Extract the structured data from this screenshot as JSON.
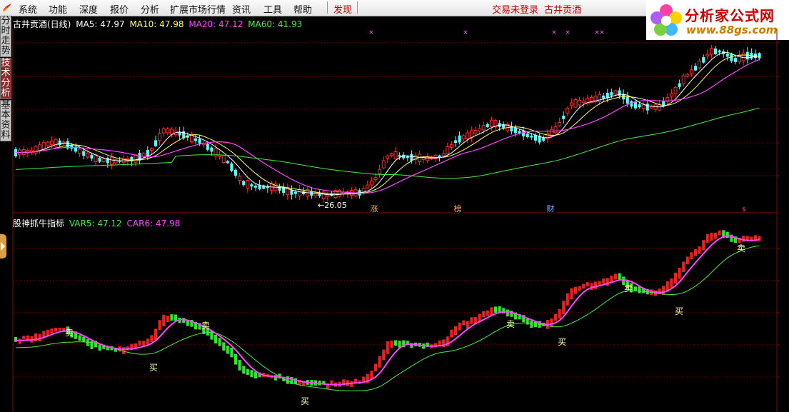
{
  "menu": {
    "items": [
      "系统",
      "功能",
      "深度",
      "报价",
      "分析",
      "扩展市场行情",
      "资讯",
      "工具",
      "帮助"
    ],
    "discover": "发现",
    "status_trade": "交易未登录",
    "status_stock": "古井贡酒"
  },
  "brand": {
    "title": "分析家公式网",
    "url": "www.88gs.com"
  },
  "side_tabs": [
    "分时走势",
    "技术分析",
    "基本资料"
  ],
  "price_panel": {
    "title": "古井贡酒(日线)",
    "ma": [
      {
        "label": "MA5: 47.97",
        "color": "#ffffff"
      },
      {
        "label": "MA10: 47.98",
        "color": "#ffff66"
      },
      {
        "label": "MA20: 47.12",
        "color": "#ff44ff"
      },
      {
        "label": "MA60: 41.93",
        "color": "#44ee44"
      }
    ],
    "low_annotation": "←26.05",
    "event_marks": [
      "涨",
      "榜",
      "财"
    ],
    "colors": {
      "up": "#ff2a2a",
      "down": "#54ffff",
      "ma5": "#ffffff",
      "ma10": "#ffff66",
      "ma20": "#ff44ff",
      "ma60": "#44ee44",
      "grid": "#8b0000"
    }
  },
  "indicator_panel": {
    "title": "股神抓牛指标",
    "legend": [
      {
        "label": "VAR5: 47.12",
        "color": "#44ee44"
      },
      {
        "label": "CAR6: 47.98",
        "color": "#ff44ff"
      }
    ],
    "signals": {
      "buy": "买",
      "sell": "卖"
    },
    "colors": {
      "up": "#ff1a1a",
      "down": "#22ee22",
      "car": "#ff44ff",
      "var": "#44ee44",
      "signal": "#ffffaa"
    }
  }
}
